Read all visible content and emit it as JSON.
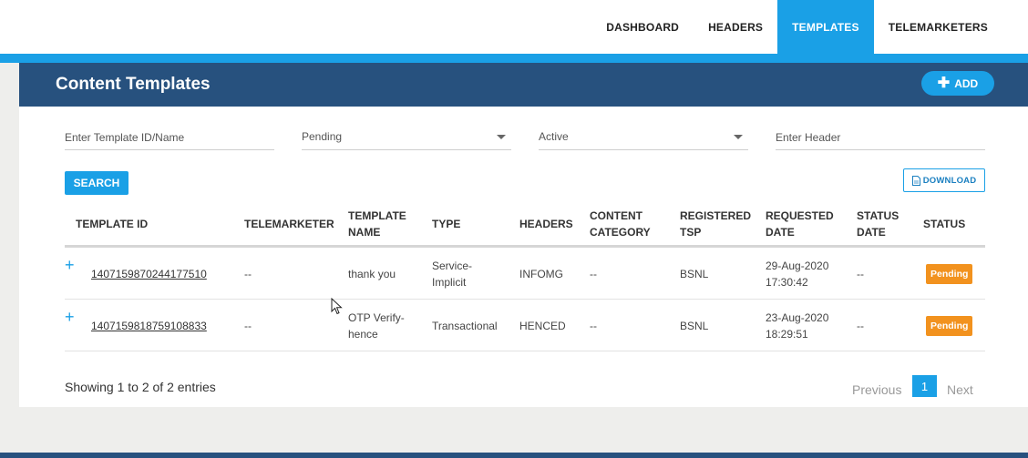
{
  "nav": {
    "items": [
      {
        "label": "DASHBOARD",
        "active": false
      },
      {
        "label": "HEADERS",
        "active": false
      },
      {
        "label": "TEMPLATES",
        "active": true
      },
      {
        "label": "TELEMARKETERS",
        "active": false
      }
    ]
  },
  "page": {
    "title": "Content Templates",
    "add_label": "ADD"
  },
  "filters": {
    "template_placeholder": "Enter Template ID/Name",
    "status_value": "Pending",
    "active_value": "Active",
    "header_placeholder": "Enter Header"
  },
  "actions": {
    "search_label": "SEARCH",
    "download_label": "DOWNLOAD"
  },
  "table": {
    "columns": [
      "TEMPLATE ID",
      "TELEMARKETER",
      "TEMPLATE NAME",
      "TYPE",
      "HEADERS",
      "CONTENT CATEGORY",
      "REGISTERED TSP",
      "REQUESTED DATE",
      "STATUS DATE",
      "STATUS"
    ],
    "rows": [
      {
        "expand": "+",
        "template_id": "1407159870244177510",
        "telemarketer": "--",
        "template_name": "thank you",
        "type": "Service-Implicit",
        "headers": "INFOMG",
        "content_category": "--",
        "registered_tsp": "BSNL",
        "requested_date": "29-Aug-2020 17:30:42",
        "status_date": "--",
        "status": "Pending"
      },
      {
        "expand": "+",
        "template_id": "1407159818759108833",
        "telemarketer": "--",
        "template_name": "OTP Verify-hence",
        "type": "Transactional",
        "headers": "HENCED",
        "content_category": "--",
        "registered_tsp": "BSNL",
        "requested_date": "23-Aug-2020 18:29:51",
        "status_date": "--",
        "status": "Pending"
      }
    ]
  },
  "pagination": {
    "summary": "Showing 1 to 2 of 2 entries",
    "previous": "Previous",
    "current_page": "1",
    "next": "Next"
  },
  "colors": {
    "accent": "#1aa0e6",
    "header_bar": "#27517e",
    "pending_badge": "#f2921e"
  }
}
